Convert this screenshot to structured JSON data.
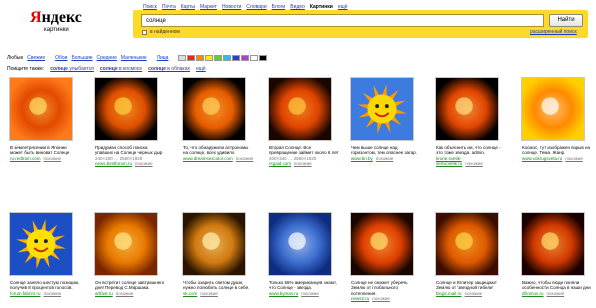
{
  "logo": {
    "first_letter": "Я",
    "rest": "ндекс",
    "subtitle": "картинки"
  },
  "nav": [
    "Поиск",
    "Почта",
    "Карты",
    "Маркет",
    "Новости",
    "Словари",
    "Блоги",
    "Видео",
    "Картинки",
    "ещё"
  ],
  "nav_active_index": 8,
  "search": {
    "query": "солнце",
    "button": "Найти",
    "found_label": "в найденном",
    "advanced": "расширенный поиск"
  },
  "filters": {
    "size_label": "Любые",
    "size_links": [
      "Свежие",
      "Обои",
      "Большие",
      "Средние",
      "Маленькие"
    ],
    "face_link": "Лица",
    "swatch_colors": [
      "#dddddd",
      "#ee2222",
      "#ff8800",
      "#ffee00",
      "#66cc33",
      "#33bbee",
      "#2244cc",
      "#aa44cc",
      "#ffffff",
      "#000000"
    ]
  },
  "related": {
    "label": "Поищите также:",
    "links": [
      {
        "bold": "солнце",
        "rest": " улыбается"
      },
      {
        "bold": "солнце",
        "rest": " в космосе"
      },
      {
        "bold": "солнце",
        "rest": " в облаках"
      },
      {
        "bold": "",
        "rest": "ещё"
      }
    ]
  },
  "results": [
    {
      "caption": "В землетрясении в Японии может быть виноват Солнце",
      "size": "",
      "site": "ru.redtram.com",
      "similar": "похожие",
      "icon": "sun-photo-icon",
      "colors": [
        "#ffe066",
        "#e24a00",
        "#ff7a1a"
      ]
    },
    {
      "caption": "Придуман способ поиска упавших на Солнце черных дыр",
      "size": "240×180 … 2560×1920",
      "site": "news.bestforum.ru",
      "similar": "похожие",
      "icon": "sun-photo-icon",
      "colors": [
        "#ffd040",
        "#e05000",
        "#000000"
      ]
    },
    {
      "caption": "То, что обнаружили астрономы на солнце, всех удивило",
      "size": "",
      "site": "www.dreamsexcolor.com",
      "similar": "похожие",
      "icon": "sun-photo-icon",
      "colors": [
        "#ffd060",
        "#e85d00",
        "#000000"
      ]
    },
    {
      "caption": "Вторая Солнце: Все превращение займет около 6 лет",
      "size": "400×340 … 2560×1920",
      "site": "rsgaid.com",
      "similar": "похожие",
      "icon": "sun-photo-icon",
      "colors": [
        "#ffc840",
        "#e04400",
        "#1a0600"
      ]
    },
    {
      "caption": "Чем выше солнце над горизонтом, тем опаснее загар.",
      "size": "",
      "site": "www.bri.by",
      "similar": "похожие",
      "icon": "cartoon-sun-icon",
      "colors": [
        "#3d7be0",
        "#ffd800",
        "#ff9900"
      ]
    },
    {
      "caption": "Как объяснить ии, что солнце - это тоже звезда. admin.",
      "size": "",
      "site": "krone.svetik-semicvetik.ru",
      "similar": "похожие",
      "icon": "sun-photo-icon",
      "colors": [
        "#ffe080",
        "#e24600",
        "#000000"
      ]
    },
    {
      "caption": "Космос, тут изображен взрыв на солнце. Тема. Жанр.",
      "size": "",
      "site": "www.vokrugsveta.ru",
      "similar": "похожие",
      "icon": "sun-photo-icon",
      "colors": [
        "#ffffff",
        "#ff8a00",
        "#ffd000"
      ]
    },
    {
      "caption": "Солнце заняло шестую позицию, получив 8 процентов голосов.",
      "size": "",
      "site": "forum.fabrirs.ru",
      "similar": "похожие",
      "icon": "cartoon-sun-icon",
      "colors": [
        "#1d4fc4",
        "#ffe000",
        "#ffb000"
      ]
    },
    {
      "caption": "Он встретит солнце завтрашнего дня! Перевод С.Маршака.",
      "size": "",
      "site": "artfast.ru",
      "similar": "похожие",
      "icon": "sun-photo-icon",
      "colors": [
        "#ffe88a",
        "#e97a00",
        "#7a2600"
      ]
    },
    {
      "caption": "Чтобы озарить светом души, нужно полюбить солнце в себе.",
      "size": "",
      "site": "vk.com",
      "similar": "похожие",
      "icon": "sun-photo-icon",
      "colors": [
        "#fff1b0",
        "#d17a10",
        "#2a1400"
      ]
    },
    {
      "caption": "Только 55% американцев знают, что Солнце - звезда.",
      "size": "",
      "site": "www.bymas.ru",
      "similar": "похожие",
      "icon": "sun-photo-icon",
      "colors": [
        "#ffffff",
        "#3d6fd0",
        "#0e2c80"
      ]
    },
    {
      "caption": "Солнце не сможет уберечь Землю от глобального потепления.",
      "size": "",
      "site": "news2.ru",
      "similar": "похожие",
      "icon": "sun-photo-icon",
      "colors": [
        "#ffe070",
        "#e04000",
        "#1a0600"
      ]
    },
    {
      "caption": "Солнце и Юпитер защищают Землю от 'звездной гибели'",
      "size": "",
      "site": "blogs.mail.ru",
      "similar": "похожие",
      "icon": "sun-photo-icon",
      "colors": [
        "#ffd64a",
        "#e05a00",
        "#3a0d00"
      ]
    },
    {
      "caption": "Важно, чтобы люди поняли особенности Солнца в наши дни",
      "size": "",
      "site": "dfromox.ru",
      "similar": "похожие",
      "icon": "sun-photo-icon",
      "colors": [
        "#ffe070",
        "#d43a00",
        "#1a0000"
      ]
    }
  ]
}
